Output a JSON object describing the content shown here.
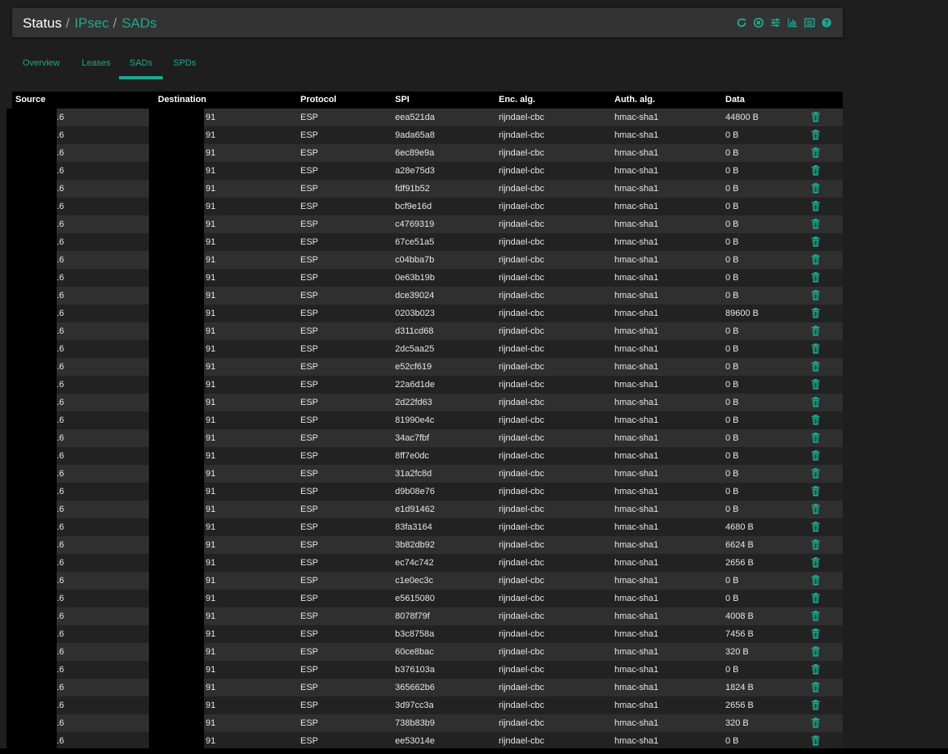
{
  "breadcrumb": {
    "root": "Status",
    "sep": "/",
    "section": "IPsec",
    "page": "SADs"
  },
  "toolbar_icons": [
    "refresh-icon",
    "stop-circle-icon",
    "sliders-icon",
    "bar-chart-icon",
    "list-icon",
    "help-icon"
  ],
  "accent_color": "#1fa891",
  "tabs": [
    {
      "label": "Overview",
      "active": false
    },
    {
      "label": "Leases",
      "active": false
    },
    {
      "label": "SADs",
      "active": true
    },
    {
      "label": "SPDs",
      "active": false
    }
  ],
  "table": {
    "headers": [
      "Source",
      "Destination",
      "Protocol",
      "SPI",
      "Enc. alg.",
      "Auth. alg.",
      "Data"
    ],
    "rows": [
      {
        "source": ".6",
        "destination": "91",
        "protocol": "ESP",
        "spi": "eea521da",
        "enc": "rijndael-cbc",
        "auth": "hmac-sha1",
        "data": "44800 B"
      },
      {
        "source": ".6",
        "destination": "91",
        "protocol": "ESP",
        "spi": "9ada65a8",
        "enc": "rijndael-cbc",
        "auth": "hmac-sha1",
        "data": "0 B"
      },
      {
        "source": ".6",
        "destination": "91",
        "protocol": "ESP",
        "spi": "6ec89e9a",
        "enc": "rijndael-cbc",
        "auth": "hmac-sha1",
        "data": "0 B"
      },
      {
        "source": ".6",
        "destination": "91",
        "protocol": "ESP",
        "spi": "a28e75d3",
        "enc": "rijndael-cbc",
        "auth": "hmac-sha1",
        "data": "0 B"
      },
      {
        "source": ".6",
        "destination": "91",
        "protocol": "ESP",
        "spi": "fdf91b52",
        "enc": "rijndael-cbc",
        "auth": "hmac-sha1",
        "data": "0 B"
      },
      {
        "source": ".6",
        "destination": "91",
        "protocol": "ESP",
        "spi": "bcf9e16d",
        "enc": "rijndael-cbc",
        "auth": "hmac-sha1",
        "data": "0 B"
      },
      {
        "source": ".6",
        "destination": "91",
        "protocol": "ESP",
        "spi": "c4769319",
        "enc": "rijndael-cbc",
        "auth": "hmac-sha1",
        "data": "0 B"
      },
      {
        "source": ".6",
        "destination": "91",
        "protocol": "ESP",
        "spi": "67ce51a5",
        "enc": "rijndael-cbc",
        "auth": "hmac-sha1",
        "data": "0 B"
      },
      {
        "source": ".6",
        "destination": "91",
        "protocol": "ESP",
        "spi": "c04bba7b",
        "enc": "rijndael-cbc",
        "auth": "hmac-sha1",
        "data": "0 B"
      },
      {
        "source": ".6",
        "destination": "91",
        "protocol": "ESP",
        "spi": "0e63b19b",
        "enc": "rijndael-cbc",
        "auth": "hmac-sha1",
        "data": "0 B"
      },
      {
        "source": ".6",
        "destination": "91",
        "protocol": "ESP",
        "spi": "dce39024",
        "enc": "rijndael-cbc",
        "auth": "hmac-sha1",
        "data": "0 B"
      },
      {
        "source": ".6",
        "destination": "91",
        "protocol": "ESP",
        "spi": "0203b023",
        "enc": "rijndael-cbc",
        "auth": "hmac-sha1",
        "data": "89600 B"
      },
      {
        "source": ".6",
        "destination": "91",
        "protocol": "ESP",
        "spi": "d311cd68",
        "enc": "rijndael-cbc",
        "auth": "hmac-sha1",
        "data": "0 B"
      },
      {
        "source": ".6",
        "destination": "91",
        "protocol": "ESP",
        "spi": "2dc5aa25",
        "enc": "rijndael-cbc",
        "auth": "hmac-sha1",
        "data": "0 B"
      },
      {
        "source": ".6",
        "destination": "91",
        "protocol": "ESP",
        "spi": "e52cf619",
        "enc": "rijndael-cbc",
        "auth": "hmac-sha1",
        "data": "0 B"
      },
      {
        "source": ".6",
        "destination": "91",
        "protocol": "ESP",
        "spi": "22a6d1de",
        "enc": "rijndael-cbc",
        "auth": "hmac-sha1",
        "data": "0 B"
      },
      {
        "source": ".6",
        "destination": "91",
        "protocol": "ESP",
        "spi": "2d22fd63",
        "enc": "rijndael-cbc",
        "auth": "hmac-sha1",
        "data": "0 B"
      },
      {
        "source": ".6",
        "destination": "91",
        "protocol": "ESP",
        "spi": "81990e4c",
        "enc": "rijndael-cbc",
        "auth": "hmac-sha1",
        "data": "0 B"
      },
      {
        "source": ".6",
        "destination": "91",
        "protocol": "ESP",
        "spi": "34ac7fbf",
        "enc": "rijndael-cbc",
        "auth": "hmac-sha1",
        "data": "0 B"
      },
      {
        "source": ".6",
        "destination": "91",
        "protocol": "ESP",
        "spi": "8ff7e0dc",
        "enc": "rijndael-cbc",
        "auth": "hmac-sha1",
        "data": "0 B"
      },
      {
        "source": ".6",
        "destination": "91",
        "protocol": "ESP",
        "spi": "31a2fc8d",
        "enc": "rijndael-cbc",
        "auth": "hmac-sha1",
        "data": "0 B"
      },
      {
        "source": ".6",
        "destination": "91",
        "protocol": "ESP",
        "spi": "d9b08e76",
        "enc": "rijndael-cbc",
        "auth": "hmac-sha1",
        "data": "0 B"
      },
      {
        "source": ".6",
        "destination": "91",
        "protocol": "ESP",
        "spi": "e1d91462",
        "enc": "rijndael-cbc",
        "auth": "hmac-sha1",
        "data": "0 B"
      },
      {
        "source": ".6",
        "destination": "91",
        "protocol": "ESP",
        "spi": "83fa3164",
        "enc": "rijndael-cbc",
        "auth": "hmac-sha1",
        "data": "4680 B"
      },
      {
        "source": ".6",
        "destination": "91",
        "protocol": "ESP",
        "spi": "3b82db92",
        "enc": "rijndael-cbc",
        "auth": "hmac-sha1",
        "data": "6624 B"
      },
      {
        "source": ".6",
        "destination": "91",
        "protocol": "ESP",
        "spi": "ec74c742",
        "enc": "rijndael-cbc",
        "auth": "hmac-sha1",
        "data": "2656 B"
      },
      {
        "source": ".6",
        "destination": "91",
        "protocol": "ESP",
        "spi": "c1e0ec3c",
        "enc": "rijndael-cbc",
        "auth": "hmac-sha1",
        "data": "0 B"
      },
      {
        "source": ".6",
        "destination": "91",
        "protocol": "ESP",
        "spi": "e5615080",
        "enc": "rijndael-cbc",
        "auth": "hmac-sha1",
        "data": "0 B"
      },
      {
        "source": ".6",
        "destination": "91",
        "protocol": "ESP",
        "spi": "8078f79f",
        "enc": "rijndael-cbc",
        "auth": "hmac-sha1",
        "data": "4008 B"
      },
      {
        "source": ".6",
        "destination": "91",
        "protocol": "ESP",
        "spi": "b3c8758a",
        "enc": "rijndael-cbc",
        "auth": "hmac-sha1",
        "data": "7456 B"
      },
      {
        "source": ".6",
        "destination": "91",
        "protocol": "ESP",
        "spi": "60ce8bac",
        "enc": "rijndael-cbc",
        "auth": "hmac-sha1",
        "data": "320 B"
      },
      {
        "source": ".6",
        "destination": "91",
        "protocol": "ESP",
        "spi": "b376103a",
        "enc": "rijndael-cbc",
        "auth": "hmac-sha1",
        "data": "0 B"
      },
      {
        "source": ".6",
        "destination": "91",
        "protocol": "ESP",
        "spi": "365662b6",
        "enc": "rijndael-cbc",
        "auth": "hmac-sha1",
        "data": "1824 B"
      },
      {
        "source": ".6",
        "destination": "91",
        "protocol": "ESP",
        "spi": "3d97cc3a",
        "enc": "rijndael-cbc",
        "auth": "hmac-sha1",
        "data": "2656 B"
      },
      {
        "source": ".6",
        "destination": "91",
        "protocol": "ESP",
        "spi": "738b83b9",
        "enc": "rijndael-cbc",
        "auth": "hmac-sha1",
        "data": "320 B"
      },
      {
        "source": ".6",
        "destination": "91",
        "protocol": "ESP",
        "spi": "ee53014e",
        "enc": "rijndael-cbc",
        "auth": "hmac-sha1",
        "data": "0 B"
      }
    ]
  }
}
